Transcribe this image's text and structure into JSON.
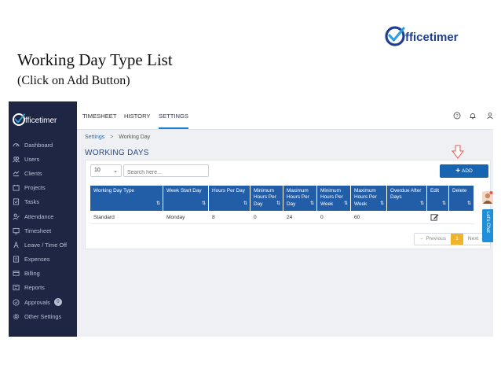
{
  "slide": {
    "title": "Working Day Type List",
    "subtitle": "(Click on Add Button)",
    "logo_o": "O",
    "logo_text": "fficetimer"
  },
  "sidebar": {
    "logo_text": "fficetimer",
    "items": [
      {
        "label": "Dashboard",
        "icon": "dashboard-icon"
      },
      {
        "label": "Users",
        "icon": "users-icon"
      },
      {
        "label": "Clients",
        "icon": "clients-icon"
      },
      {
        "label": "Projects",
        "icon": "projects-icon"
      },
      {
        "label": "Tasks",
        "icon": "tasks-icon"
      },
      {
        "label": "Attendance",
        "icon": "attendance-icon"
      },
      {
        "label": "Timesheet",
        "icon": "timesheet-icon"
      },
      {
        "label": "Leave / Time Off",
        "icon": "leave-icon"
      },
      {
        "label": "Expenses",
        "icon": "expenses-icon"
      },
      {
        "label": "Billing",
        "icon": "billing-icon"
      },
      {
        "label": "Reports",
        "icon": "reports-icon"
      },
      {
        "label": "Approvals",
        "icon": "approvals-icon",
        "badge": "0"
      },
      {
        "label": "Other Settings",
        "icon": "settings-icon"
      }
    ]
  },
  "topbar": {
    "tabs": [
      "TIMESHEET",
      "HISTORY",
      "SETTINGS"
    ],
    "active_tab": "SETTINGS"
  },
  "breadcrumb": {
    "parent": "Settings",
    "separator": ">",
    "current": "Working Day"
  },
  "page": {
    "title": "WORKING DAYS"
  },
  "controls": {
    "page_size": "10",
    "search_placeholder": "Search here...",
    "add_label": "ADD"
  },
  "table": {
    "columns": [
      "Working Day Type",
      "Week Start Day",
      "Hours Per Day",
      "Minimum Hours Per Day",
      "Maximum Hours Per Day",
      "Minimum Hours Per Week",
      "Maximum Hours Per Week",
      "Overdue After Days",
      "Edit",
      "Delete"
    ],
    "rows": [
      [
        "Standard",
        "Monday",
        "8",
        "0",
        "24",
        "0",
        "60",
        "",
        "",
        ""
      ]
    ]
  },
  "pagination": {
    "previous": "← Previous",
    "current": "1",
    "next": "Next →"
  },
  "chat": {
    "label": "Let's Chat"
  },
  "colors": {
    "sidebar_bg": "#1f2643",
    "table_header": "#225ea8",
    "add_button": "#1765b1",
    "page_active": "#f0b429",
    "chat_tab": "#1e8fd8",
    "annotation_arrow": "#e25b4f"
  }
}
